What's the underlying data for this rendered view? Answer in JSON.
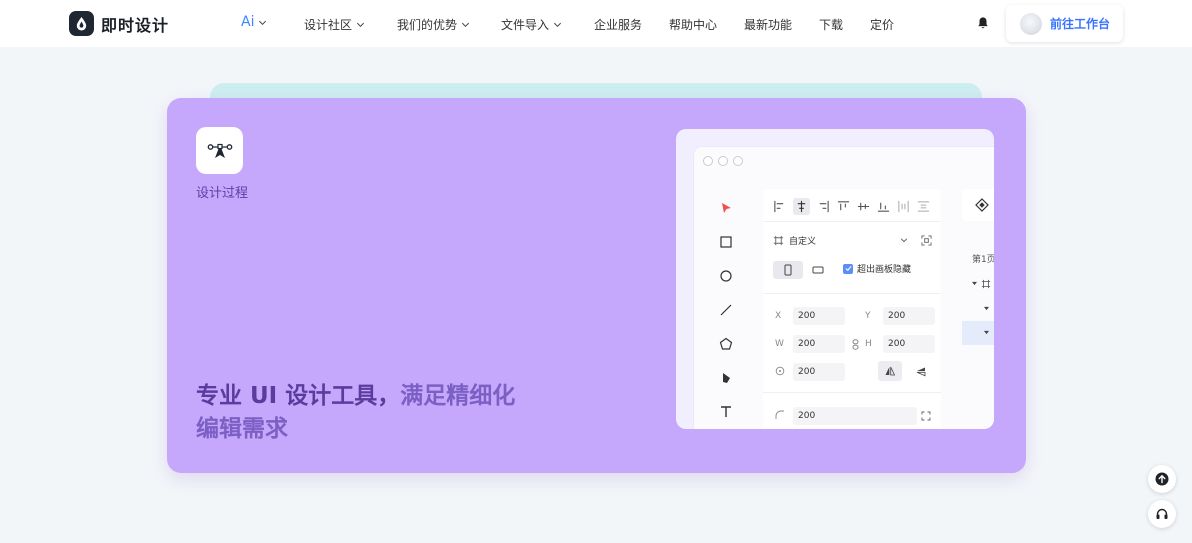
{
  "brand": {
    "name": "即时设计"
  },
  "nav": {
    "ai": "Ai",
    "items": [
      {
        "label": "设计社区",
        "has_dropdown": true
      },
      {
        "label": "我们的优势",
        "has_dropdown": true
      },
      {
        "label": "文件导入",
        "has_dropdown": true
      },
      {
        "label": "企业服务",
        "has_dropdown": false
      },
      {
        "label": "帮助中心",
        "has_dropdown": false
      },
      {
        "label": "最新功能",
        "has_dropdown": false
      },
      {
        "label": "下载",
        "has_dropdown": false
      },
      {
        "label": "定价",
        "has_dropdown": false
      }
    ],
    "workbench_label": "前往工作台"
  },
  "feature": {
    "label": "设计过程",
    "headline_main": "专业 UI 设计工具，",
    "headline_rest": "满足精细化编辑需求",
    "card_color": "#c5a8fb"
  },
  "mock": {
    "preset_label": "自定义",
    "clip_label": "超出画板隐藏",
    "props": {
      "x_key": "X",
      "x": "200",
      "y_key": "Y",
      "y": "200",
      "w_key": "W",
      "w": "200",
      "h_key": "H",
      "h": "200",
      "rotation": "200",
      "radius": "200"
    },
    "page_label": "第1页"
  },
  "colors": {
    "accent": "#3f86ff",
    "brand_dark": "#1f2733",
    "cursor_red": "#f0504f"
  }
}
